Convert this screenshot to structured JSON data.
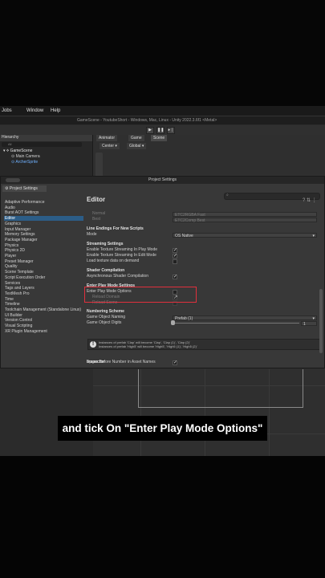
{
  "menubar": {
    "items": [
      "Jobs",
      "Window",
      "Help"
    ]
  },
  "window_title": "GameScene - YoutubeShort - Windows, Mac, Linux - Unity 2022.3.6f1 <Metal>",
  "hierarchy": {
    "tab": "Hierarchy",
    "search_placeholder": "All",
    "items": [
      "GameScene",
      "Main Camera",
      "ArcherSprite"
    ]
  },
  "scene_tabs": [
    "Animator",
    "Game",
    "Scene"
  ],
  "scene_toolbar": [
    "Center",
    "Global"
  ],
  "project_settings": {
    "title": "Project Settings",
    "tab": "Project Settings",
    "categories": [
      "Adaptive Performance",
      "Audio",
      "Burst AOT Settings",
      "Editor",
      "Graphics",
      "Input Manager",
      "Memory Settings",
      "Package Manager",
      "Physics",
      "Physics 2D",
      "Player",
      "Preset Manager",
      "Quality",
      "Scene Template",
      "Script Execution Order",
      "Services",
      "Tags and Layers",
      "TextMesh Pro",
      "Time",
      "Timeline",
      "Toolchain Management (Standalone Linux)",
      "UI Builder",
      "Version Control",
      "Visual Scripting",
      "XR Plugin Management"
    ],
    "selected_category": "Editor",
    "heading": "Editor",
    "normal_label": "Normal",
    "normal_value": "ETC2RGBA Fast",
    "best_label": "Best",
    "best_value": "ETC2Comp Best",
    "line_endings": {
      "header": "Line Endings For New Scripts",
      "mode_label": "Mode",
      "mode_value": "OS Native"
    },
    "streaming": {
      "header": "Streaming Settings",
      "items": [
        {
          "label": "Enable Texture Streaming In Play Mode",
          "checked": true
        },
        {
          "label": "Enable Texture Streaming In Edit Mode",
          "checked": true
        },
        {
          "label": "Load texture data on demand",
          "checked": false
        }
      ]
    },
    "shader": {
      "header": "Shader Compilation",
      "label": "Asynchronous Shader Compilation",
      "checked": true
    },
    "enter_play_mode": {
      "header": "Enter Play Mode Settings",
      "options_label": "Enter Play Mode Options",
      "reload_domain": "Reload Domain",
      "reload_scene": "Reload Scene"
    },
    "numbering": {
      "header": "Numbering Scheme",
      "naming_label": "Game Object Naming",
      "naming_value": "Prefab (1)",
      "digits_label": "Game Object Digits",
      "digits_value": "1",
      "info_line1": "Instances of prefab 'Clap' will become 'Clap', 'Clap (1)', 'Clap (2)'",
      "info_line2": "Instances of prefab 'High5' will become 'High5', 'High5 (1)', 'High5 (2)'",
      "space_label": "Space Before Number in Asset Names",
      "space_checked": true
    },
    "inspector_header": "Inspector"
  },
  "caption": "and tick On \"Enter Play Mode Options\""
}
